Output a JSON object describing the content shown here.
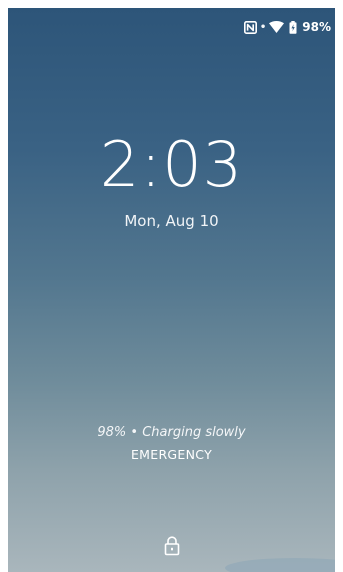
{
  "status_bar": {
    "icons": [
      "nfc-icon",
      "wifi-icon",
      "battery-icon"
    ],
    "battery_percent": "98%"
  },
  "lockscreen": {
    "time": "2:03",
    "date": "Mon, Aug 10",
    "charging_status": "98% • Charging slowly",
    "emergency_label": "EMERGENCY",
    "lock_icon": "lock-icon"
  },
  "colors": {
    "wallpaper_top": "#2d5579",
    "wallpaper_bottom": "#a9b6bc",
    "text": "#ffffff"
  }
}
